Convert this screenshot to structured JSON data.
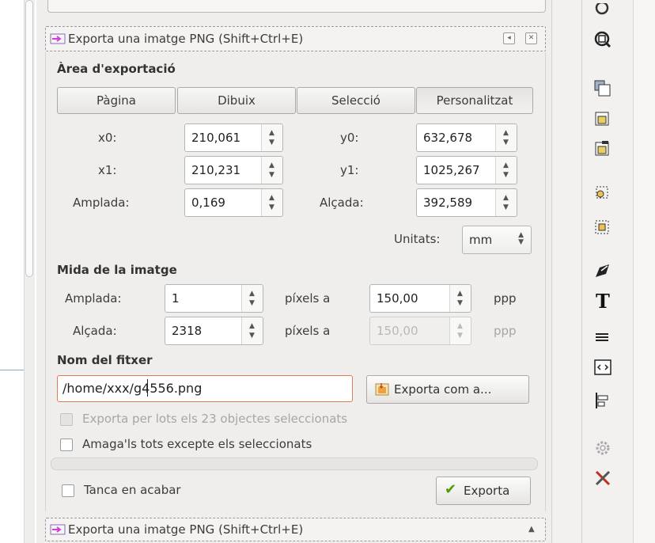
{
  "panel": {
    "header_title": "Exporta una imatge PNG (Shift+Ctrl+E)",
    "footer_title": "Exporta una imatge PNG (Shift+Ctrl+E)"
  },
  "export_area": {
    "title": "Àrea d'exportació",
    "buttons": [
      "Pàgina",
      "Dibuix",
      "Selecció",
      "Personalitzat"
    ],
    "active_button": "Personalitzat",
    "x0_label": "x0:",
    "x0_value": "210,061",
    "y0_label": "y0:",
    "y0_value": "632,678",
    "x1_label": "x1:",
    "x1_value": "210,231",
    "y1_label": "y1:",
    "y1_value": "1025,267",
    "width_label": "Amplada:",
    "width_value": "0,169",
    "height_label": "Alçada:",
    "height_value": "392,589",
    "units_label": "Unitats:",
    "units_value": "mm"
  },
  "image_size": {
    "title": "Mida de la imatge",
    "width_label": "Amplada:",
    "width_value": "1",
    "height_label": "Alçada:",
    "height_value": "2318",
    "pixels_at": "píxels a",
    "dpi_x": "150,00",
    "dpi_y": "150,00",
    "dpi_unit": "ppp"
  },
  "filename": {
    "title": "Nom del fitxer",
    "value": "/home/xxx/g4556.png",
    "export_as_label": "Exporta com a..."
  },
  "options": {
    "batch_label": "Exporta per lots els 23 objectes seleccionats",
    "hide_label": "Amaga'ls tots excepte els seleccionats",
    "close_label": "Tanca en acabar"
  },
  "export_button": "Exporta",
  "colors": {
    "accent_border": "#e07a50",
    "panel_bg": "#efeeec"
  }
}
